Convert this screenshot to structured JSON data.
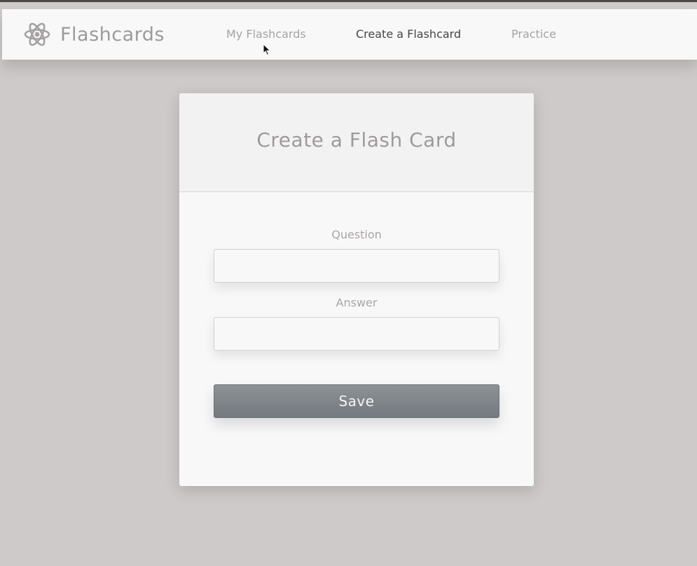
{
  "nav": {
    "brand_name": "Flashcards",
    "brand_icon": "atom-icon",
    "links": [
      {
        "label": "My Flashcards",
        "active": false
      },
      {
        "label": "Create a Flashcard",
        "active": true
      },
      {
        "label": "Practice",
        "active": false
      }
    ]
  },
  "card": {
    "title": "Create a Flash Card",
    "question_label": "Question",
    "question_value": "",
    "answer_label": "Answer",
    "answer_value": "",
    "save_label": "Save"
  },
  "colors": {
    "background": "#cfcaca",
    "navbar": "#f9f8f8",
    "card": "#f9f8f8",
    "save_button": "#7f8489",
    "active_link": "#474545"
  }
}
